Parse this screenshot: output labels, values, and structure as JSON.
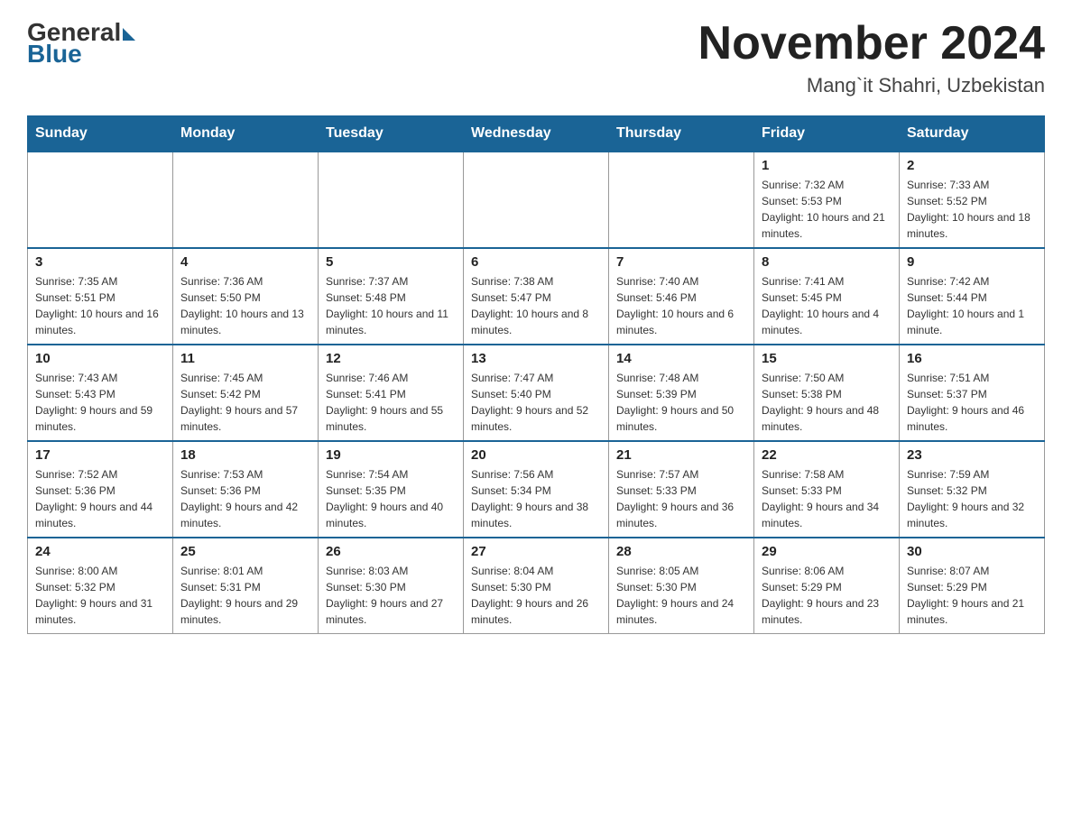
{
  "header": {
    "logo_general": "General",
    "logo_blue": "Blue",
    "month_year": "November 2024",
    "location": "Mang`it Shahri, Uzbekistan"
  },
  "weekdays": [
    "Sunday",
    "Monday",
    "Tuesday",
    "Wednesday",
    "Thursday",
    "Friday",
    "Saturday"
  ],
  "weeks": [
    [
      {
        "day": "",
        "info": ""
      },
      {
        "day": "",
        "info": ""
      },
      {
        "day": "",
        "info": ""
      },
      {
        "day": "",
        "info": ""
      },
      {
        "day": "",
        "info": ""
      },
      {
        "day": "1",
        "info": "Sunrise: 7:32 AM\nSunset: 5:53 PM\nDaylight: 10 hours and 21 minutes."
      },
      {
        "day": "2",
        "info": "Sunrise: 7:33 AM\nSunset: 5:52 PM\nDaylight: 10 hours and 18 minutes."
      }
    ],
    [
      {
        "day": "3",
        "info": "Sunrise: 7:35 AM\nSunset: 5:51 PM\nDaylight: 10 hours and 16 minutes."
      },
      {
        "day": "4",
        "info": "Sunrise: 7:36 AM\nSunset: 5:50 PM\nDaylight: 10 hours and 13 minutes."
      },
      {
        "day": "5",
        "info": "Sunrise: 7:37 AM\nSunset: 5:48 PM\nDaylight: 10 hours and 11 minutes."
      },
      {
        "day": "6",
        "info": "Sunrise: 7:38 AM\nSunset: 5:47 PM\nDaylight: 10 hours and 8 minutes."
      },
      {
        "day": "7",
        "info": "Sunrise: 7:40 AM\nSunset: 5:46 PM\nDaylight: 10 hours and 6 minutes."
      },
      {
        "day": "8",
        "info": "Sunrise: 7:41 AM\nSunset: 5:45 PM\nDaylight: 10 hours and 4 minutes."
      },
      {
        "day": "9",
        "info": "Sunrise: 7:42 AM\nSunset: 5:44 PM\nDaylight: 10 hours and 1 minute."
      }
    ],
    [
      {
        "day": "10",
        "info": "Sunrise: 7:43 AM\nSunset: 5:43 PM\nDaylight: 9 hours and 59 minutes."
      },
      {
        "day": "11",
        "info": "Sunrise: 7:45 AM\nSunset: 5:42 PM\nDaylight: 9 hours and 57 minutes."
      },
      {
        "day": "12",
        "info": "Sunrise: 7:46 AM\nSunset: 5:41 PM\nDaylight: 9 hours and 55 minutes."
      },
      {
        "day": "13",
        "info": "Sunrise: 7:47 AM\nSunset: 5:40 PM\nDaylight: 9 hours and 52 minutes."
      },
      {
        "day": "14",
        "info": "Sunrise: 7:48 AM\nSunset: 5:39 PM\nDaylight: 9 hours and 50 minutes."
      },
      {
        "day": "15",
        "info": "Sunrise: 7:50 AM\nSunset: 5:38 PM\nDaylight: 9 hours and 48 minutes."
      },
      {
        "day": "16",
        "info": "Sunrise: 7:51 AM\nSunset: 5:37 PM\nDaylight: 9 hours and 46 minutes."
      }
    ],
    [
      {
        "day": "17",
        "info": "Sunrise: 7:52 AM\nSunset: 5:36 PM\nDaylight: 9 hours and 44 minutes."
      },
      {
        "day": "18",
        "info": "Sunrise: 7:53 AM\nSunset: 5:36 PM\nDaylight: 9 hours and 42 minutes."
      },
      {
        "day": "19",
        "info": "Sunrise: 7:54 AM\nSunset: 5:35 PM\nDaylight: 9 hours and 40 minutes."
      },
      {
        "day": "20",
        "info": "Sunrise: 7:56 AM\nSunset: 5:34 PM\nDaylight: 9 hours and 38 minutes."
      },
      {
        "day": "21",
        "info": "Sunrise: 7:57 AM\nSunset: 5:33 PM\nDaylight: 9 hours and 36 minutes."
      },
      {
        "day": "22",
        "info": "Sunrise: 7:58 AM\nSunset: 5:33 PM\nDaylight: 9 hours and 34 minutes."
      },
      {
        "day": "23",
        "info": "Sunrise: 7:59 AM\nSunset: 5:32 PM\nDaylight: 9 hours and 32 minutes."
      }
    ],
    [
      {
        "day": "24",
        "info": "Sunrise: 8:00 AM\nSunset: 5:32 PM\nDaylight: 9 hours and 31 minutes."
      },
      {
        "day": "25",
        "info": "Sunrise: 8:01 AM\nSunset: 5:31 PM\nDaylight: 9 hours and 29 minutes."
      },
      {
        "day": "26",
        "info": "Sunrise: 8:03 AM\nSunset: 5:30 PM\nDaylight: 9 hours and 27 minutes."
      },
      {
        "day": "27",
        "info": "Sunrise: 8:04 AM\nSunset: 5:30 PM\nDaylight: 9 hours and 26 minutes."
      },
      {
        "day": "28",
        "info": "Sunrise: 8:05 AM\nSunset: 5:30 PM\nDaylight: 9 hours and 24 minutes."
      },
      {
        "day": "29",
        "info": "Sunrise: 8:06 AM\nSunset: 5:29 PM\nDaylight: 9 hours and 23 minutes."
      },
      {
        "day": "30",
        "info": "Sunrise: 8:07 AM\nSunset: 5:29 PM\nDaylight: 9 hours and 21 minutes."
      }
    ]
  ]
}
